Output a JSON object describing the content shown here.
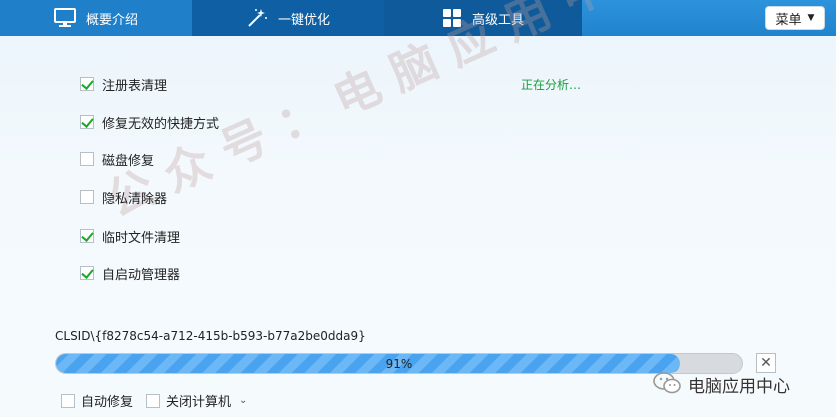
{
  "nav": {
    "tabs": [
      {
        "label": "概要介绍",
        "icon": "monitor-icon"
      },
      {
        "label": "一键优化",
        "icon": "magic-wand-icon"
      },
      {
        "label": "高级工具",
        "icon": "grid-icon"
      }
    ],
    "menu_label": "菜单"
  },
  "checklist": [
    {
      "label": "注册表清理",
      "checked": true
    },
    {
      "label": "修复无效的快捷方式",
      "checked": true
    },
    {
      "label": "磁盘修复",
      "checked": false
    },
    {
      "label": "隐私清除器",
      "checked": false
    },
    {
      "label": "临时文件清理",
      "checked": true
    },
    {
      "label": "自启动管理器",
      "checked": true
    }
  ],
  "status": "正在分析…",
  "watermark": "公众号：电脑应用中心",
  "current_path": "CLSID\\{f8278c54-a712-415b-b593-b77a2be0dda9}",
  "progress": {
    "percent": 91,
    "label": "91%"
  },
  "cancel_icon": "close-icon",
  "options": [
    {
      "label": "自动修复",
      "checked": false
    },
    {
      "label": "关闭计算机",
      "checked": false,
      "has_dropdown": true
    }
  ],
  "badge": {
    "label": "电脑应用中心",
    "icon": "wechat-icon"
  },
  "colors": {
    "accent": "#1b7cc6",
    "check": "#19a82a",
    "status": "#1a9e3c",
    "progress": "#4aa3ef"
  }
}
